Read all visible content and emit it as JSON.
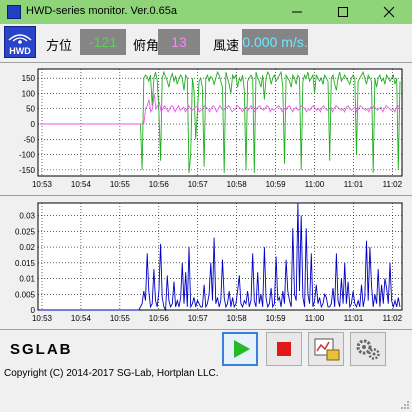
{
  "window": {
    "title": "HWD-series monitor. Ver.0.65a",
    "logo_text": "HWD",
    "title_bg": "#8fd478"
  },
  "readouts": [
    {
      "label": "方位",
      "value": "-121",
      "color": "#5ad05a"
    },
    {
      "label": "俯角",
      "value": "13",
      "color": "#ff80ff"
    },
    {
      "label": "風速",
      "value": "0.000 m/s.",
      "color": "#6fe8ff"
    }
  ],
  "chart_data": [
    {
      "type": "line",
      "ylim": [
        -170,
        180
      ],
      "yticks": [
        150,
        100,
        50,
        0,
        -50,
        -100,
        -150
      ],
      "xticks": [
        "10:53",
        "10:54",
        "10:55",
        "10:56",
        "10:57",
        "10:58",
        "10:59",
        "11:00",
        "11:01",
        "11:02"
      ],
      "grid": true,
      "series": [
        {
          "color": "#20b020",
          "values": [
            0,
            0,
            0,
            0,
            0,
            0,
            0,
            0,
            0,
            0,
            0,
            0,
            0,
            0,
            0,
            0,
            0,
            0,
            0,
            0,
            0,
            0,
            0,
            0,
            0,
            0,
            0,
            0,
            0,
            0,
            0,
            0,
            0,
            0,
            0,
            0,
            0,
            0,
            0,
            0,
            0,
            0,
            0,
            0,
            0,
            0,
            0,
            0,
            0,
            0,
            0,
            0,
            0,
            0,
            0,
            0,
            0,
            0,
            0,
            0,
            0,
            -150,
            150,
            160,
            155,
            140,
            160,
            60,
            150,
            170,
            145,
            40,
            -120,
            150,
            170,
            155,
            140,
            120,
            150,
            165,
            140,
            155,
            130,
            150,
            160,
            150,
            110,
            160,
            150,
            -160,
            -100,
            150,
            110,
            -50,
            40,
            140,
            150,
            120,
            -140,
            150,
            160,
            140,
            155,
            150,
            130,
            150,
            170,
            160,
            140,
            120,
            -160,
            170,
            150,
            130,
            100,
            160,
            150,
            160,
            120,
            150,
            140,
            160,
            110,
            -150,
            140,
            150,
            160,
            150,
            -160,
            170,
            150,
            140,
            120,
            160,
            80,
            150,
            170,
            160,
            130,
            150,
            160,
            140,
            150,
            160,
            170,
            120,
            -130,
            160,
            150,
            140,
            120,
            160,
            150,
            130,
            160,
            150,
            -150,
            140,
            160,
            150,
            170,
            140,
            150,
            160,
            100,
            160,
            150,
            140,
            150,
            130,
            160,
            150,
            140,
            -120,
            150,
            160,
            130,
            110,
            150,
            170,
            140,
            150,
            160,
            150,
            140,
            130,
            150,
            160,
            150,
            -100,
            140,
            150,
            160,
            170,
            150,
            130,
            160,
            150,
            140,
            -160,
            150,
            120,
            150,
            160,
            140,
            150,
            130,
            160,
            150,
            140,
            150,
            160,
            130,
            150,
            -150,
            140
          ]
        },
        {
          "color": "#ee55ee",
          "values": [
            0,
            0,
            0,
            0,
            0,
            0,
            0,
            0,
            0,
            0,
            0,
            0,
            0,
            0,
            0,
            0,
            0,
            0,
            0,
            0,
            0,
            0,
            0,
            0,
            0,
            0,
            0,
            0,
            0,
            0,
            0,
            0,
            0,
            0,
            0,
            0,
            0,
            0,
            0,
            0,
            0,
            0,
            0,
            0,
            0,
            0,
            0,
            0,
            0,
            0,
            0,
            0,
            0,
            0,
            0,
            0,
            0,
            0,
            0,
            0,
            0,
            50,
            60,
            80,
            40,
            50,
            100,
            50,
            60,
            70,
            40,
            50,
            60,
            50,
            40,
            50,
            60,
            55,
            40,
            50,
            60,
            45,
            50,
            55,
            40,
            50,
            60,
            50,
            45,
            50,
            55,
            60,
            40,
            45,
            50,
            60,
            55,
            50,
            40,
            50,
            60,
            55,
            40,
            50,
            60,
            50,
            45,
            50,
            55,
            60,
            50,
            40,
            45,
            50,
            60,
            55,
            50,
            40,
            50,
            55,
            45,
            50,
            60,
            50,
            40,
            50,
            55,
            60,
            50,
            45,
            50,
            60,
            55,
            40,
            50,
            45,
            50,
            55,
            60,
            50,
            40,
            50,
            45,
            55,
            60,
            50,
            40,
            50,
            55,
            45,
            50,
            60,
            55,
            50,
            40,
            50,
            45,
            55,
            60,
            50,
            45,
            50,
            40,
            55,
            60,
            50,
            45,
            50,
            55,
            40,
            50,
            60,
            55,
            50,
            45,
            50,
            40,
            55,
            60,
            50,
            45,
            50,
            55,
            40,
            50,
            60,
            55,
            50,
            45,
            50,
            40,
            55,
            50,
            60,
            50,
            45,
            50,
            55,
            40,
            50,
            60,
            55,
            50,
            45,
            50,
            40,
            55,
            60,
            50
          ]
        }
      ]
    },
    {
      "type": "line",
      "ylim": [
        0,
        0.034
      ],
      "yticks": [
        0.03,
        0.025,
        0.02,
        0.015,
        0.01,
        0.005,
        0
      ],
      "xticks": [
        "10:53",
        "10:54",
        "10:55",
        "10:56",
        "10:57",
        "10:58",
        "10:59",
        "11:00",
        "11:01",
        "11:02"
      ],
      "grid": true,
      "series": [
        {
          "color": "#0000c8",
          "values": [
            0,
            0,
            0,
            0,
            0,
            0,
            0,
            0,
            0,
            0,
            0,
            0,
            0,
            0,
            0,
            0,
            0,
            0,
            0,
            0,
            0,
            0,
            0,
            0,
            0,
            0,
            0,
            0,
            0,
            0,
            0,
            0,
            0,
            0,
            0,
            0,
            0,
            0,
            0,
            0,
            0,
            0,
            0,
            0,
            0,
            0,
            0,
            0,
            0,
            0,
            0,
            0,
            0,
            0,
            0,
            0,
            0,
            0,
            0,
            0,
            0.001,
            0.002,
            0.006,
            0.003,
            0.018,
            0.006,
            0.001,
            0.002,
            0.013,
            0.003,
            0.001,
            0.006,
            0.021,
            0.004,
            0.001,
            0.0,
            0.011,
            0.003,
            0.001,
            0.002,
            0.009,
            0.001,
            0.003,
            0.001,
            0.004,
            0.015,
            0.002,
            0.012,
            0.001,
            0.02,
            0.001,
            0.002,
            0.004,
            0.001,
            0.003,
            0.002,
            0.001,
            0.001,
            0.008,
            0.001,
            0.002,
            0.005,
            0.015,
            0.003,
            0.023,
            0.002,
            0.004,
            0.001,
            0.003,
            0.016,
            0.004,
            0.001,
            0.002,
            0.006,
            0.001,
            0.004,
            0.001,
            0.002,
            0.006,
            0.011,
            0.002,
            0.001,
            0.003,
            0.002,
            0.006,
            0.001,
            0.003,
            0.018,
            0.003,
            0.001,
            0.012,
            0.002,
            0.005,
            0.001,
            0.02,
            0.004,
            0.001,
            0.002,
            0.007,
            0.001,
            0.002,
            0.017,
            0.003,
            0.004,
            0.001,
            0.006,
            0.002,
            0.016,
            0.006,
            0.003,
            0.001,
            0.026,
            0.005,
            0.003,
            0.034,
            0.006,
            0.03,
            0.004,
            0.001,
            0.026,
            0.005,
            0.002,
            0.018,
            0.001,
            0.003,
            0.008,
            0.002,
            0.004,
            0.001,
            0.002,
            0.005,
            0.004,
            0.001,
            0.001,
            0.002,
            0.007,
            0.001,
            0.018,
            0.003,
            0.001,
            0.01,
            0.002,
            0.015,
            0.002,
            0.009,
            0.001,
            0.002,
            0.006,
            0.002,
            0.001,
            0.003,
            0.001,
            0.008,
            0.001,
            0.004,
            0.022,
            0.003,
            0.02,
            0.008,
            0.001,
            0.005,
            0.002,
            0.013,
            0.001,
            0.008,
            0.002,
            0.01,
            0.007,
            0.002,
            0.015,
            0.003,
            0.001,
            0.003,
            0.001,
            0.004,
            0.001
          ]
        }
      ]
    }
  ],
  "controls": {
    "brand": "SGLAB",
    "play_color": "#28b828",
    "stop_color": "#e01818"
  },
  "footer": {
    "copyright": "Copyright (C) 2014-2017 SG-Lab, Hortplan LLC."
  }
}
